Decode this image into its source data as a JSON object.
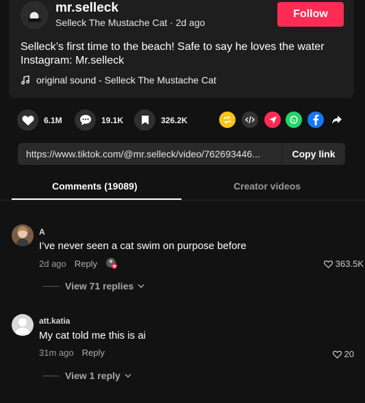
{
  "author": {
    "username": "mr.selleck",
    "display_name": "Selleck The Mustache Cat",
    "time_ago": "2d ago",
    "subline": "Selleck The Mustache Cat · 2d ago",
    "follow_label": "Follow"
  },
  "post": {
    "caption_line1": "Selleck’s first time to the beach! Safe to say he loves the water",
    "caption_line2": "Instagram: Mr.selleck",
    "sound": "original sound - Selleck The Mustache Cat"
  },
  "actions": {
    "likes": "6.1M",
    "comments": "19.1K",
    "saves": "326.2K"
  },
  "share_icons": [
    "repost-icon",
    "embed-icon",
    "send-icon",
    "whatsapp-icon",
    "facebook-icon",
    "share-arrow-icon"
  ],
  "link": {
    "url": "https://www.tiktok.com/@mr.selleck/video/762693446...",
    "copy_label": "Copy link"
  },
  "tabs": {
    "comments": "Comments (19089)",
    "creator": "Creator videos"
  },
  "comments": [
    {
      "name": "A",
      "text": "I’ve never seen a cat swim on purpose before",
      "time": "2d ago",
      "reply": "Reply",
      "likes": "363.5K",
      "view_replies": "View 71 replies"
    },
    {
      "name": "att.katia",
      "text": "My cat told me this is ai",
      "time": "31m ago",
      "reply": "Reply",
      "likes": "20",
      "view_replies": "View 1 reply"
    }
  ],
  "colors": {
    "accent": "#fe2c55",
    "background": "#121212",
    "card": "#1e1e1e"
  }
}
